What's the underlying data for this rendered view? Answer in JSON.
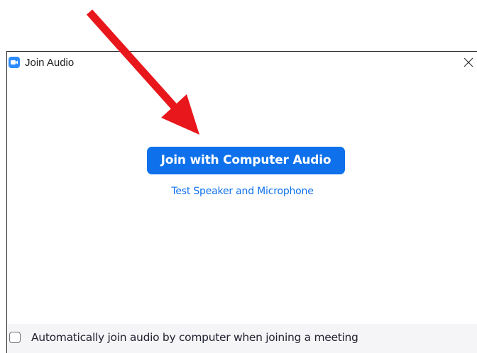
{
  "window": {
    "title": "Join Audio",
    "app_icon": "video-camera-icon",
    "close_icon": "close-icon"
  },
  "main": {
    "join_button_label": "Join with Computer Audio",
    "test_link_label": "Test Speaker and Microphone"
  },
  "footer": {
    "checkbox_checked": false,
    "checkbox_label": "Automatically join audio by computer when joining a meeting"
  },
  "annotation": {
    "icon": "red-arrow-icon",
    "color": "#e8171c"
  },
  "colors": {
    "accent": "#0e71eb",
    "app_icon": "#2d8cff",
    "footer_bg": "#f5f5f7"
  }
}
